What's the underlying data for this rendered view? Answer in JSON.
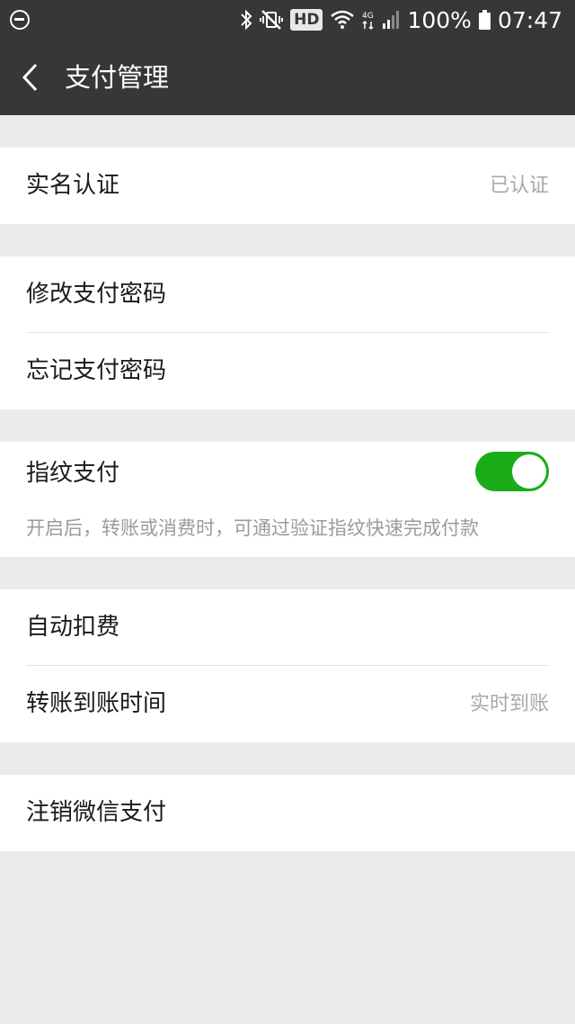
{
  "status_bar": {
    "battery": "100%",
    "time": "07:47",
    "hd": "HD",
    "network": "4G"
  },
  "header": {
    "title": "支付管理",
    "back_icon": "chevron-left-icon"
  },
  "section_identity": {
    "real_name_label": "实名认证",
    "real_name_value": "已认证"
  },
  "section_password": {
    "change_label": "修改支付密码",
    "forgot_label": "忘记支付密码"
  },
  "section_fingerprint": {
    "label": "指纹支付",
    "enabled": true,
    "hint": "开启后，转账或消费时，可通过验证指纹快速完成付款"
  },
  "section_payments": {
    "auto_deduct_label": "自动扣费",
    "transfer_time_label": "转账到账时间",
    "transfer_time_value": "实时到账"
  },
  "section_cancel": {
    "cancel_label": "注销微信支付"
  },
  "colors": {
    "bar": "#373737",
    "background": "#ebebeb",
    "toggle_on": "#1aad19"
  }
}
